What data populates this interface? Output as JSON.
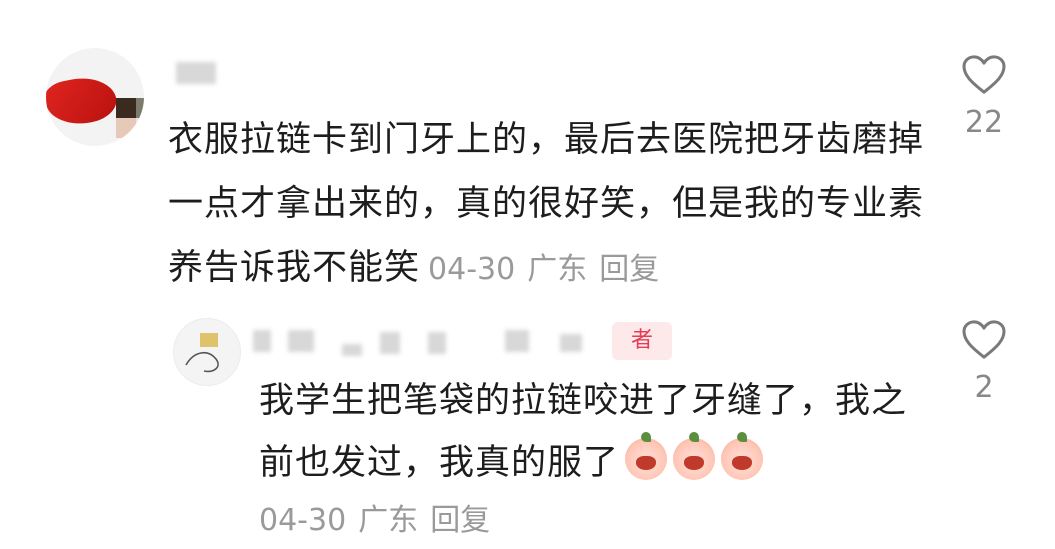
{
  "comment": {
    "text": "衣服拉链卡到门牙上的，最后去医院把牙齿磨掉一点才拿出来的，真的很好笑，但是我的专业素养告诉我不能笑",
    "time": "04-30",
    "location": "广东",
    "reply_label": "回复",
    "like_count": "22"
  },
  "reply": {
    "author_badge": "者",
    "text": "我学生把笔袋的拉链咬进了牙缝了，我之前也发过，我真的服了",
    "emojis": [
      "crying-emoji",
      "crying-emoji",
      "crying-emoji"
    ],
    "time": "04-30",
    "location": "广东",
    "reply_label": "回复",
    "like_count": "2"
  },
  "colors": {
    "text": "#1d1d1d",
    "meta": "#9a9a9a",
    "badge_bg": "#fde8ea",
    "badge_text": "#e83a52"
  }
}
